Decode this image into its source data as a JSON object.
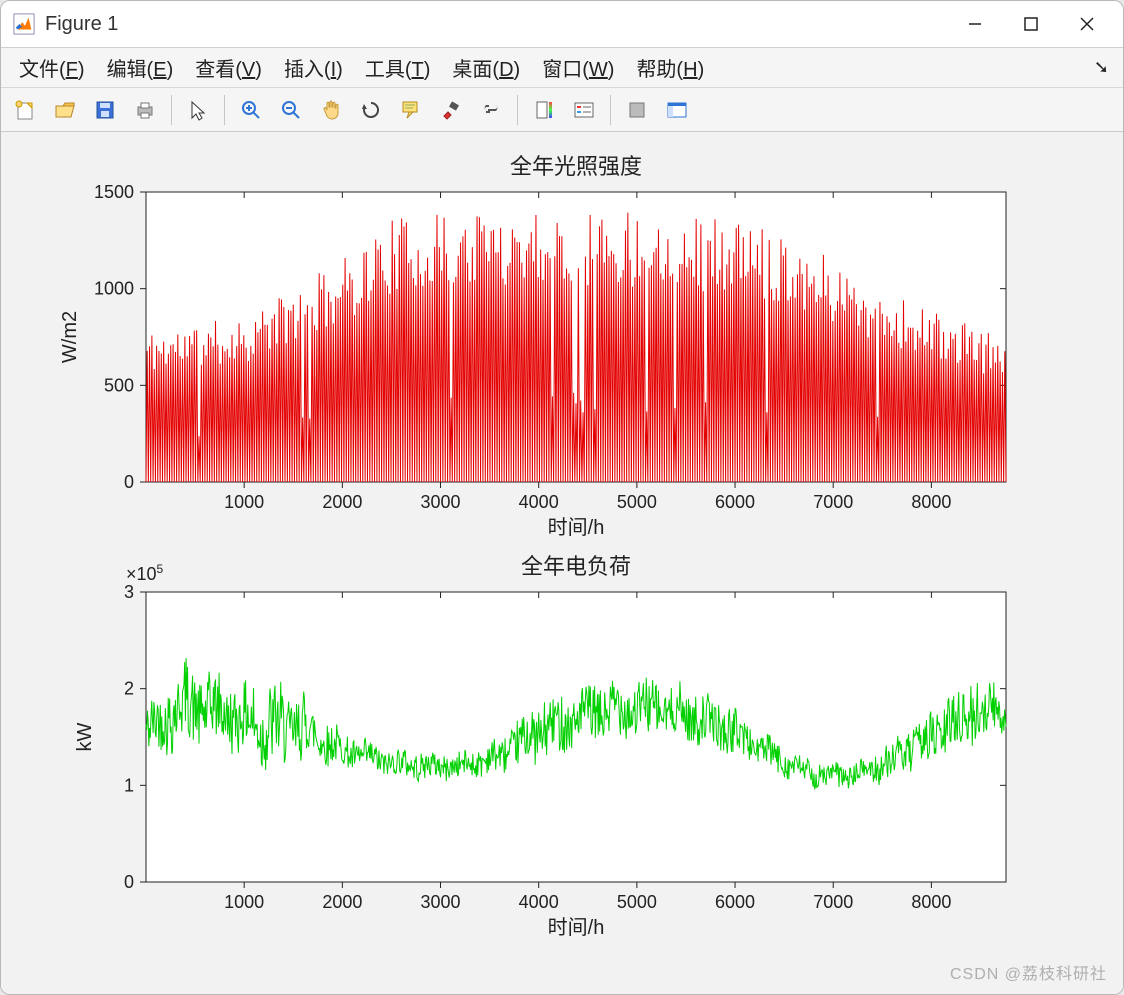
{
  "window": {
    "title": "Figure 1"
  },
  "menu": {
    "items": [
      {
        "prefix": "文件(",
        "ul": "F",
        "suffix": ")"
      },
      {
        "prefix": "编辑(",
        "ul": "E",
        "suffix": ")"
      },
      {
        "prefix": "查看(",
        "ul": "V",
        "suffix": ")"
      },
      {
        "prefix": "插入(",
        "ul": "I",
        "suffix": ")"
      },
      {
        "prefix": "工具(",
        "ul": "T",
        "suffix": ")"
      },
      {
        "prefix": "桌面(",
        "ul": "D",
        "suffix": ")"
      },
      {
        "prefix": "窗口(",
        "ul": "W",
        "suffix": ")"
      },
      {
        "prefix": "帮助(",
        "ul": "H",
        "suffix": ")"
      }
    ]
  },
  "watermark": "CSDN @荔枝科研社",
  "chart_data": [
    {
      "type": "line",
      "title": "全年光照强度",
      "xlabel": "时间/h",
      "ylabel": "W/m2",
      "xlim": [
        0,
        8760
      ],
      "ylim": [
        0,
        1500
      ],
      "xticks": [
        1000,
        2000,
        3000,
        4000,
        5000,
        6000,
        7000,
        8000
      ],
      "yticks": [
        0,
        500,
        1000,
        1500
      ],
      "color": "#e40000",
      "description": "Hourly solar irradiance over one year (8760 h). Dense daily spikes from 0 up to a seasonal envelope peaking ~1350 W/m2 around h=2500–5500, lower (~700–800 W/m2 peaks) near h=0 and h=8760; occasional dips to ~300–600 W/m2 on cloudy days.",
      "envelope_samples": {
        "x": [
          0,
          500,
          1000,
          1500,
          2000,
          2500,
          3000,
          3500,
          4000,
          4500,
          5000,
          5500,
          6000,
          6500,
          7000,
          7500,
          8000,
          8500,
          8760
        ],
        "peak": [
          750,
          780,
          820,
          950,
          1100,
          1300,
          1320,
          1350,
          1360,
          1350,
          1340,
          1330,
          1290,
          1240,
          1100,
          950,
          850,
          750,
          730
        ]
      }
    },
    {
      "type": "line",
      "title": "全年电负荷",
      "xlabel": "时间/h",
      "ylabel": "kW",
      "y_exponent_label": "×10^5",
      "xlim": [
        0,
        8760
      ],
      "ylim": [
        0,
        3
      ],
      "y_scale": 100000.0,
      "xticks": [
        1000,
        2000,
        3000,
        4000,
        5000,
        6000,
        7000,
        8000
      ],
      "yticks": [
        0,
        1,
        2,
        3
      ],
      "color": "#00d000",
      "description": "Hourly electrical load over one year. Values mostly between ~1.0×10^5 and ~2.2×10^5 kW. Higher and more variable in early year (peaks up to ~2.7×10^5 near h≈600), dip to ~0.9×10^5 around h≈3000, rise through summer (h≈4000–6000) to ~2.2×10^5, trough near h≈7000 (~1.0×10^5), then climbs toward year end (~2.3×10^5).",
      "trend_samples": {
        "x": [
          0,
          400,
          800,
          1200,
          1600,
          2000,
          2400,
          2800,
          3200,
          3600,
          4000,
          4400,
          4800,
          5200,
          5600,
          6000,
          6400,
          6800,
          7200,
          7600,
          8000,
          8400,
          8760
        ],
        "mean": [
          1.55,
          1.85,
          1.75,
          1.6,
          1.6,
          1.35,
          1.25,
          1.2,
          1.2,
          1.3,
          1.55,
          1.7,
          1.8,
          1.8,
          1.7,
          1.55,
          1.3,
          1.1,
          1.1,
          1.25,
          1.5,
          1.75,
          1.8
        ],
        "amp": [
          0.35,
          0.55,
          0.45,
          0.6,
          0.45,
          0.25,
          0.2,
          0.18,
          0.18,
          0.25,
          0.4,
          0.4,
          0.4,
          0.4,
          0.35,
          0.3,
          0.22,
          0.18,
          0.18,
          0.25,
          0.35,
          0.45,
          0.4
        ]
      }
    }
  ]
}
